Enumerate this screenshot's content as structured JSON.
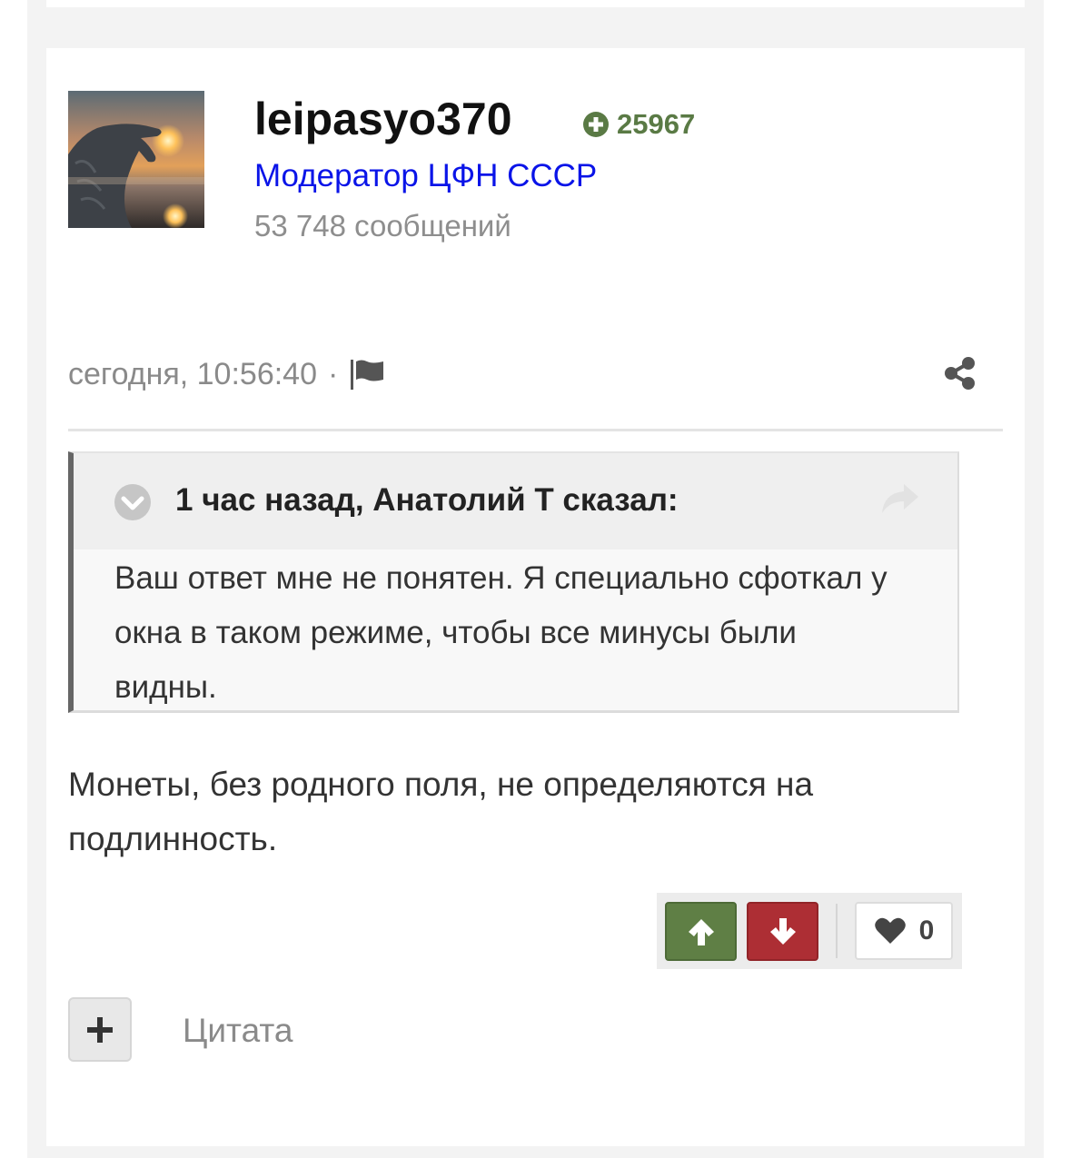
{
  "author": {
    "username": "leipasyo370",
    "reputation": "25967",
    "group": "Модератор ЦФН СССР",
    "post_count": "53 748 сообщений",
    "avatar_icon": "avatar-hand-sunset"
  },
  "post_meta": {
    "date": "сегодня, 10:56:40",
    "separator": "·",
    "report_icon": "flag-icon",
    "share_icon": "share-icon"
  },
  "quote": {
    "citation": "1 час назад, Анатолий Т сказал:",
    "body": "Ваш ответ мне не понятен. Я специально сфоткал у окна в таком режиме, чтобы все минусы были видны.",
    "toggle_icon": "chevron-down-icon",
    "goto_icon": "share-arrow-icon"
  },
  "post": {
    "text": "Монеты, без родного поля, не определяются на подлинность."
  },
  "reactions": {
    "like_count": "0"
  },
  "actions": {
    "quote_label": "Цитата"
  },
  "colors": {
    "reputation": "#5a7a45",
    "group_link": "#0a14e8",
    "vote_up": "#5f7f45",
    "vote_down": "#ad2e34"
  }
}
